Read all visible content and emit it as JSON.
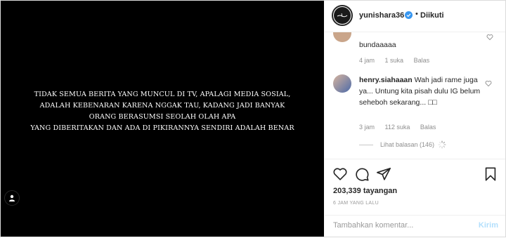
{
  "post": {
    "overlay_lines": [
      "TIDAK SEMUA BERITA YANG MUNCUL DI TV, APALAGI MEDIA SOSIAL,",
      "ADALAH KEBENARAN KARENA NGGAK TAU, KADANG JADI BANYAK",
      "ORANG BERASUMSI SEOLAH OLAH APA",
      "YANG DIBERITAKAN DAN ADA DI PIKIRANNYA SENDIRI ADALAH BENAR"
    ]
  },
  "header": {
    "username": "yunishara36",
    "dot": "•",
    "follow_label": "Diikuti"
  },
  "comments": [
    {
      "text": "bundaaaaa",
      "time": "4 jam",
      "likes": "1 suka",
      "reply_label": "Balas"
    },
    {
      "username": "henry.siahaaan",
      "text": "Wah jadi rame juga ya... Untung kita pisah dulu IG belum seheboh sekarang... □□",
      "time": "3 jam",
      "likes": "112 suka",
      "reply_label": "Balas",
      "view_replies": "Lihat balasan (146)"
    }
  ],
  "stats": {
    "views_count": "203,339",
    "views_label": "tayangan",
    "time_ago": "6 JAM YANG LALU"
  },
  "comment_box": {
    "placeholder": "Tambahkan komentar...",
    "post_label": "Kirim"
  },
  "colors": {
    "verified": "#3897f0",
    "post_button_disabled": "#b2dffc",
    "media_background": "#000000"
  }
}
